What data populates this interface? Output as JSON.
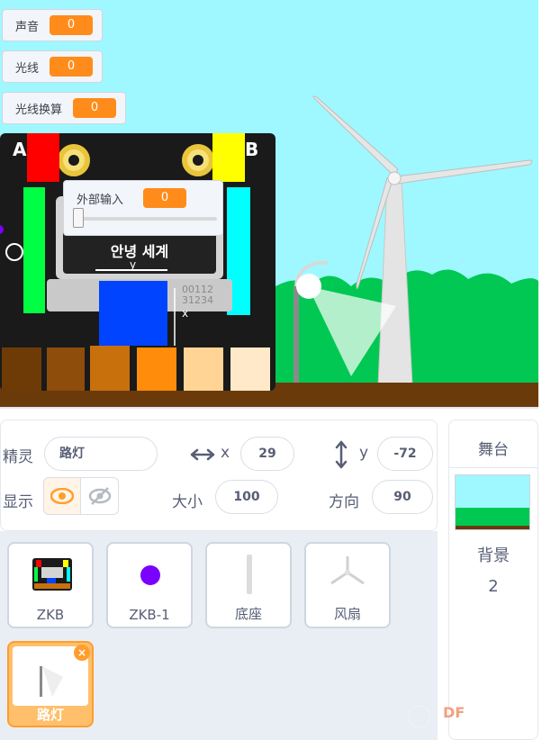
{
  "stage": {
    "monitors": [
      {
        "label": "声音",
        "value": "0"
      },
      {
        "label": "光线",
        "value": "0"
      },
      {
        "label": "光线换算",
        "value": "0"
      }
    ],
    "slider": {
      "label": "外部输入",
      "value": "0"
    },
    "board": {
      "letter_a": "A",
      "letter_b": "B",
      "screen_text": "안녕 세계",
      "code": "00112\n31234",
      "y_label": "y",
      "x_label": "x"
    }
  },
  "sprite_info": {
    "sprite_label": "精灵",
    "sprite_name": "路灯",
    "x_label": "x",
    "x_value": "29",
    "y_label": "y",
    "y_value": "-72",
    "show_label": "显示",
    "size_label": "大小",
    "size_value": "100",
    "direction_label": "方向",
    "direction_value": "90"
  },
  "sprites": [
    {
      "name": "ZKB"
    },
    {
      "name": "ZKB-1"
    },
    {
      "name": "底座"
    },
    {
      "name": "风扇"
    },
    {
      "name": "路灯",
      "selected": true
    }
  ],
  "stage_panel": {
    "title": "舞台",
    "backdrop_label": "背景",
    "backdrop_count": "2"
  },
  "watermark": "DF",
  "colors": {
    "accent": "#ff8c1a",
    "sky": "#9ff8ff",
    "grass": "#00c853",
    "ground": "#6b3a0b"
  }
}
